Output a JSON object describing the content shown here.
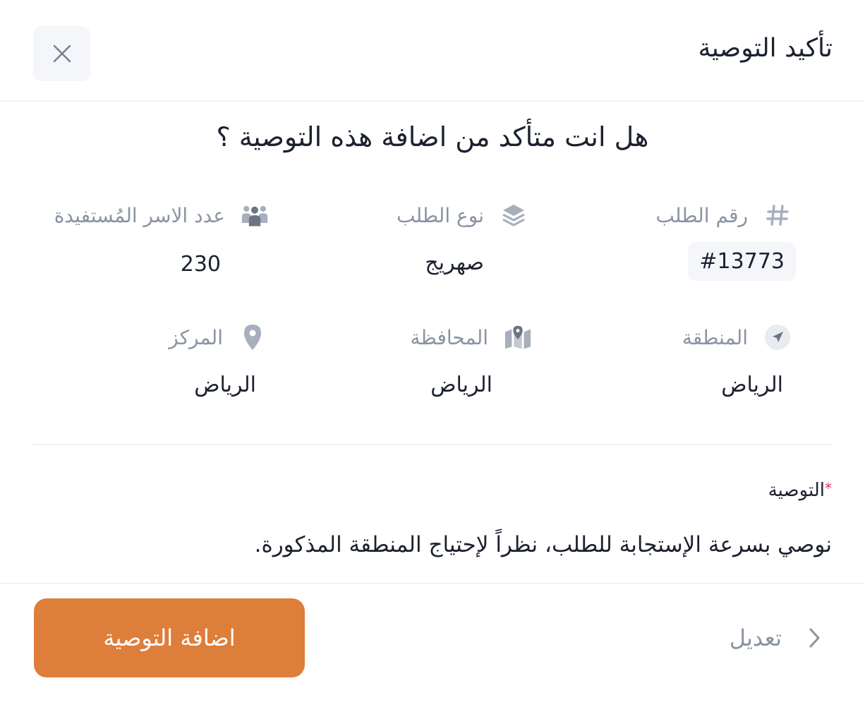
{
  "dialog": {
    "title": "تأكيد التوصية",
    "close_icon": "close-icon"
  },
  "question": "هل انت متأكد من اضافة هذه التوصية ؟",
  "info": {
    "request_number": {
      "label": "رقم الطلب",
      "value": "#13773",
      "icon": "hash-icon"
    },
    "request_type": {
      "label": "نوع الطلب",
      "value": "صهريج",
      "icon": "layers-icon"
    },
    "families": {
      "label": "عدد الاسر المُستفيدة",
      "value": "230",
      "icon": "users-icon"
    },
    "region": {
      "label": "المنطقة",
      "value": "الرياض",
      "icon": "navigation-icon"
    },
    "governorate": {
      "label": "المحافظة",
      "value": "الرياض",
      "icon": "map-icon"
    },
    "center": {
      "label": "المركز",
      "value": "الرياض",
      "icon": "location-pin-icon"
    }
  },
  "recommendation": {
    "label": "التوصية",
    "required_mark": "*",
    "text": "نوصي بسرعة الإستجابة للطلب، نظراً لإحتياج المنطقة المذكورة."
  },
  "footer": {
    "add_label": "اضافة التوصية",
    "edit_label": "تعديل",
    "edit_icon": "chevron-left-icon"
  },
  "colors": {
    "primary": "#dd7e3a",
    "muted_text": "#8a93a3",
    "icon": "#a7afbd",
    "required": "#e0305a"
  }
}
